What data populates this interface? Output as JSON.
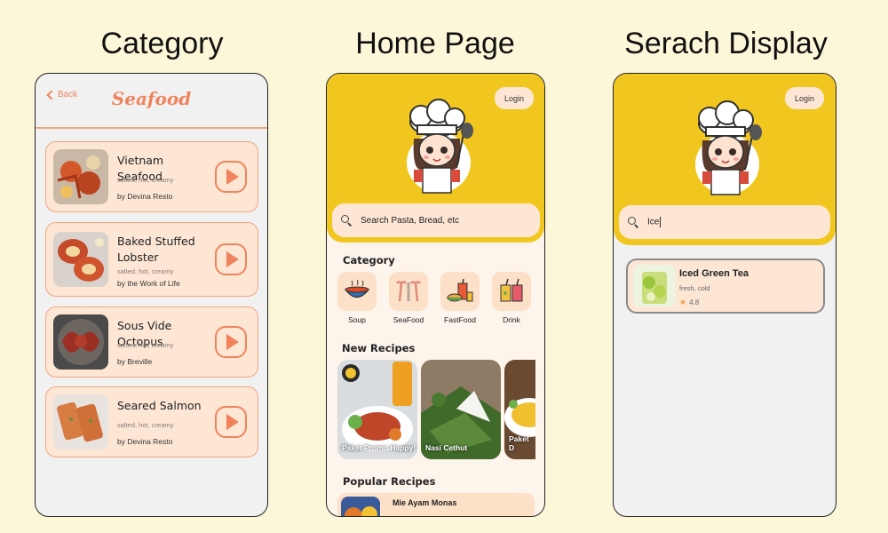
{
  "headings": {
    "category": "Category",
    "home": "Home Page",
    "search": "Serach Display"
  },
  "category_screen": {
    "back_label": "Back",
    "title": "Seafood",
    "recipes": [
      {
        "name": "Vietnam Seafood",
        "tags": "salted, hot, creamy",
        "by": "by Devina Resto"
      },
      {
        "name": "Baked Stuffed Lobster",
        "tags": "salted, hot, creamy",
        "by": "by the Work of Life"
      },
      {
        "name": "Sous Vide Octopus",
        "tags": "salted, hot, creamy",
        "by": "by Breville"
      },
      {
        "name": "Seared Salmon",
        "tags": "salted, hot, creamy",
        "by": "by Devina Resto"
      }
    ]
  },
  "home_screen": {
    "login_label": "Login",
    "search_placeholder": "Search Pasta, Bread, etc",
    "category_title": "Category",
    "categories": [
      {
        "label": "Soup",
        "icon": "soup-bowl-icon"
      },
      {
        "label": "SeaFood",
        "icon": "seafood-icon"
      },
      {
        "label": "FastFood",
        "icon": "fast-food-icon"
      },
      {
        "label": "Drink",
        "icon": "drink-icon"
      }
    ],
    "new_recipes_title": "New Recipes",
    "new_recipes": [
      {
        "caption": "Paket Promo Happy!"
      },
      {
        "caption": "Nasi Cethut"
      },
      {
        "caption": "Paket D"
      }
    ],
    "popular_title": "Popular Recipes",
    "popular": [
      {
        "name": "Mie Ayam Monas"
      }
    ]
  },
  "search_screen": {
    "login_label": "Login",
    "search_value": "Ice",
    "result": {
      "name": "Iced Green Tea",
      "tags": "fresh, cold",
      "rating": "4.8"
    }
  },
  "colors": {
    "accent": "#f0835b",
    "yellow": "#f1c71f",
    "card": "#fde6d4",
    "background": "#fcf7d9"
  }
}
